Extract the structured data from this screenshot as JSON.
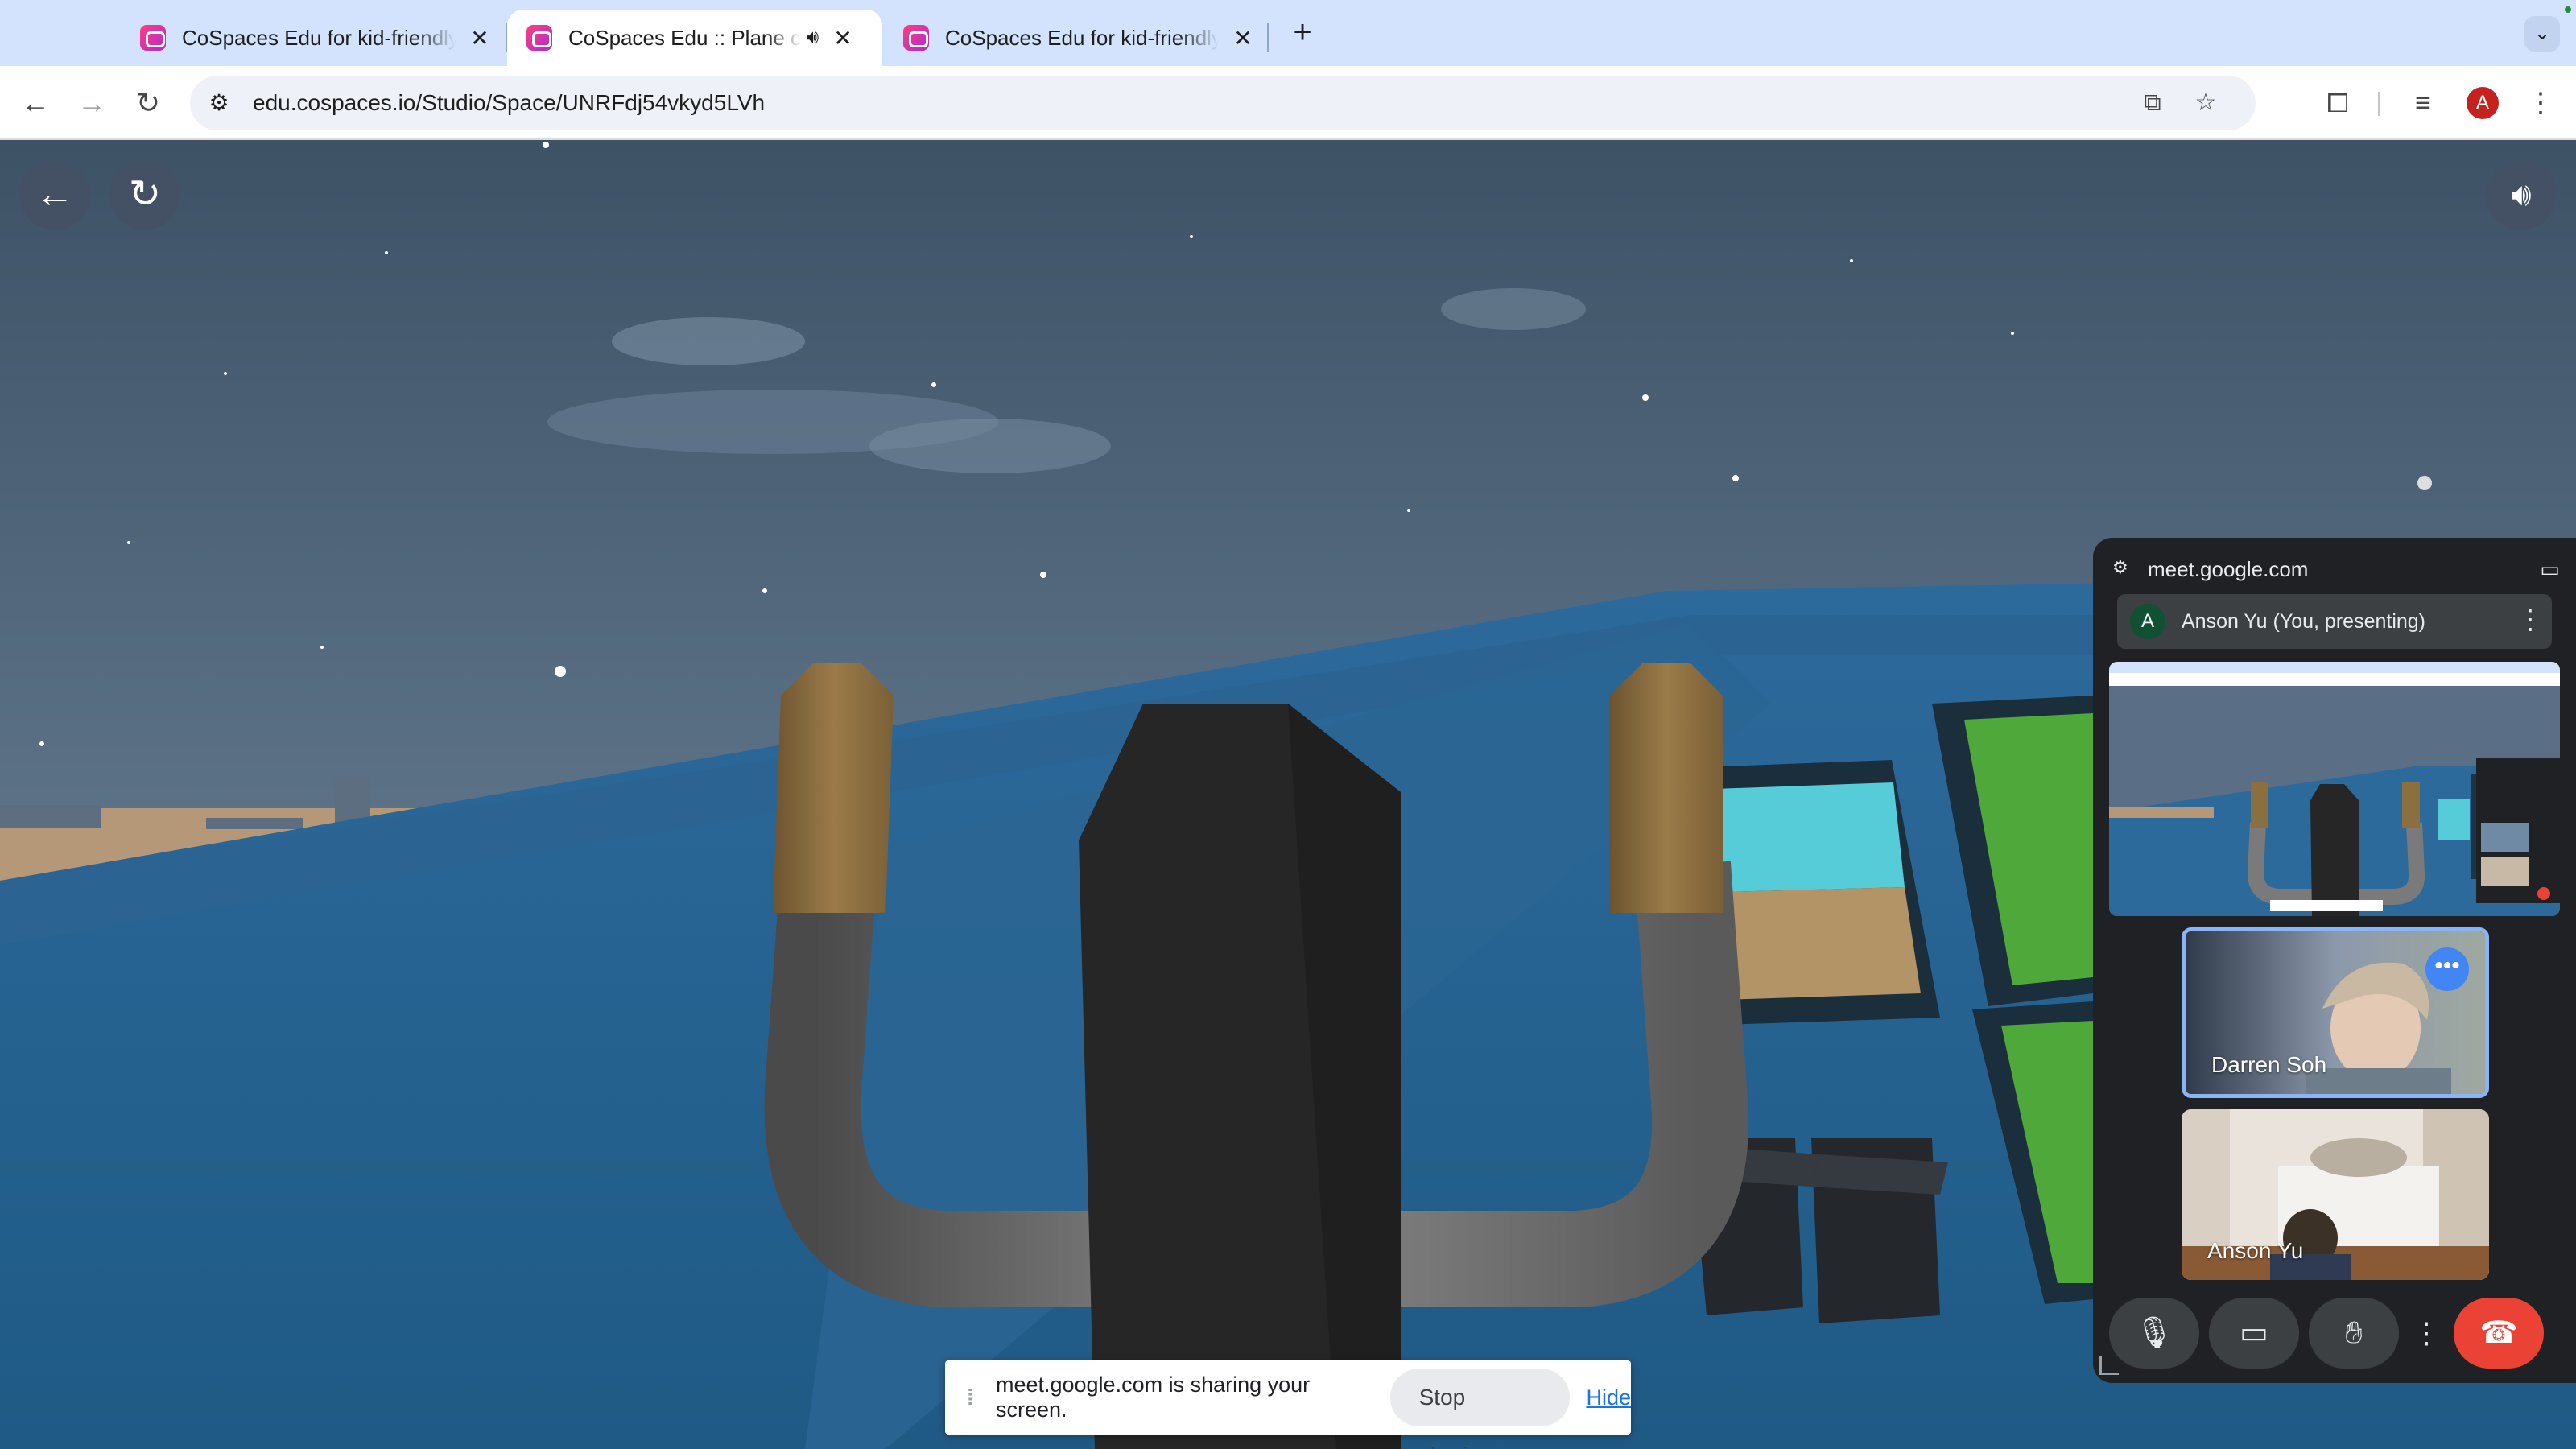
{
  "browser": {
    "tabs": [
      {
        "title": "CoSpaces Edu for kid-friendly",
        "active": false
      },
      {
        "title": "CoSpaces Edu :: Plane cra",
        "active": true,
        "audio_icon": "speaker-icon"
      },
      {
        "title": "CoSpaces Edu for kid-friendly",
        "active": false
      }
    ],
    "url": "edu.cospaces.io/Studio/Space/UNRFdj54vkyd5LVh",
    "profile_initial": "A",
    "colors": {
      "tabstrip": "#d3e3fd",
      "profile": "#c5221f"
    }
  },
  "scene": {
    "back_icon": "arrow-left-icon",
    "restart_icon": "restart-icon",
    "volume_icon": "volume-icon"
  },
  "share_banner": {
    "message": "meet.google.com is sharing your screen.",
    "stop_label": "Stop sharing",
    "hide_label": "Hide"
  },
  "meet": {
    "host": "meet.google.com",
    "presenter": {
      "initial": "A",
      "name": "Anson Yu (You, presenting)"
    },
    "participants": [
      {
        "name": "Darren Soh",
        "speaking": true
      },
      {
        "name": "Anson Yu",
        "speaking": false
      }
    ],
    "controls": [
      "mic-icon",
      "camera-icon",
      "raise-hand-icon",
      "more-options-icon",
      "hang-up-icon"
    ],
    "colors": {
      "hang_up": "#ea4335",
      "speaking_border": "#8ab4f8"
    }
  }
}
